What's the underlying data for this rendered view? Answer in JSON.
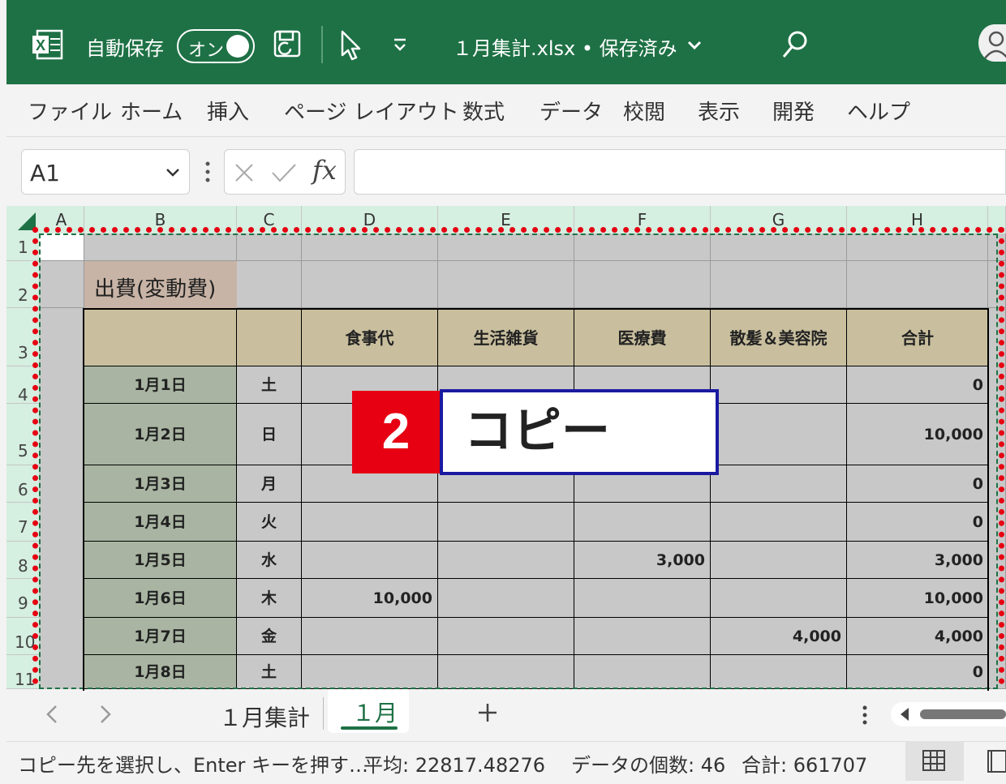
{
  "titlebar": {
    "autosave_label": "自動保存",
    "toggle_label": "オン",
    "file_title": "１月集計.xlsx • 保存済み",
    "chevron": "⌄"
  },
  "ribbon_tabs": [
    "ファイル",
    "ホーム",
    "挿入",
    "ページ レイアウト",
    "数式",
    "データ",
    "校閲",
    "表示",
    "開発",
    "ヘルプ"
  ],
  "formula_bar": {
    "name_box": "A1",
    "fx": "fx",
    "formula": ""
  },
  "columns": [
    "A",
    "B",
    "C",
    "D",
    "E",
    "F",
    "G",
    "H"
  ],
  "rows": [
    "1",
    "2",
    "3",
    "4",
    "5",
    "6",
    "7",
    "8",
    "9",
    "10",
    "11"
  ],
  "sheet": {
    "title": "出費(変動費)",
    "headers": [
      "食事代",
      "生活雑貨",
      "医療費",
      "散髪＆美容院",
      "合計"
    ],
    "data": [
      {
        "date": "1月1日",
        "day": "土",
        "food": "",
        "goods": "",
        "medical": "",
        "salon": "",
        "total": "0"
      },
      {
        "date": "1月2日",
        "day": "日",
        "food": "",
        "goods": "",
        "medical": "",
        "salon": "",
        "total": "10,000"
      },
      {
        "date": "1月3日",
        "day": "月",
        "food": "",
        "goods": "",
        "medical": "",
        "salon": "",
        "total": "0"
      },
      {
        "date": "1月4日",
        "day": "火",
        "food": "",
        "goods": "",
        "medical": "",
        "salon": "",
        "total": "0"
      },
      {
        "date": "1月5日",
        "day": "水",
        "food": "",
        "goods": "",
        "medical": "3,000",
        "salon": "",
        "total": "3,000"
      },
      {
        "date": "1月6日",
        "day": "木",
        "food": "10,000",
        "goods": "",
        "medical": "",
        "salon": "",
        "total": "10,000"
      },
      {
        "date": "1月7日",
        "day": "金",
        "food": "",
        "goods": "",
        "medical": "",
        "salon": "4,000",
        "total": "4,000"
      },
      {
        "date": "1月8日",
        "day": "土",
        "food": "",
        "goods": "",
        "medical": "",
        "salon": "",
        "total": "0"
      }
    ]
  },
  "callout": {
    "step": "2",
    "text": "コピー"
  },
  "sheet_tabs": [
    "１月集計",
    "１月"
  ],
  "active_sheet_index": 1,
  "status": {
    "message": "コピー先を選択し、Enter キーを押す…",
    "average": "平均: 22817.48276",
    "count": "データの個数: 46",
    "sum": "合計: 661707"
  },
  "colors": {
    "excel_green": "#1e7145",
    "header_tan": "#c9bf9e",
    "date_green": "#a9b5a2",
    "callout_red": "#e60012",
    "callout_border": "#1a1aa0"
  }
}
